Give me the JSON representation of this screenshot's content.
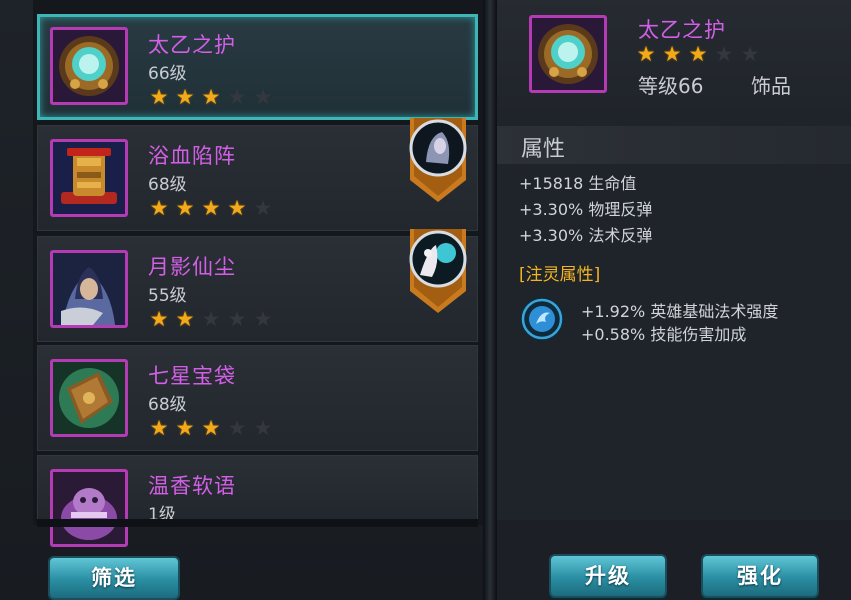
{
  "equipment_list": [
    {
      "name": "太乙之护",
      "level": "66级",
      "stars": 3,
      "max_stars": 5,
      "selected": true,
      "badge": false
    },
    {
      "name": "浴血陷阵",
      "level": "68级",
      "stars": 4,
      "max_stars": 5,
      "selected": false,
      "badge": true
    },
    {
      "name": "月影仙尘",
      "level": "55级",
      "stars": 2,
      "max_stars": 5,
      "selected": false,
      "badge": true
    },
    {
      "name": "七星宝袋",
      "level": "68级",
      "stars": 3,
      "max_stars": 5,
      "selected": false,
      "badge": false
    },
    {
      "name": "温香软语",
      "level": "1级",
      "stars": 0,
      "max_stars": 5,
      "selected": false,
      "badge": false
    }
  ],
  "buttons": {
    "filter": "筛选",
    "upgrade": "升级",
    "enhance": "强化"
  },
  "detail": {
    "name": "太乙之护",
    "stars": 3,
    "max_stars": 5,
    "level": "等级66",
    "type": "饰品",
    "attributes_title": "属性",
    "attributes": [
      "+15818 生命值",
      "+3.30% 物理反弹",
      "+3.30% 法术反弹"
    ],
    "infuse_title": "[注灵属性]",
    "infuse_attributes": [
      "+1.92% 英雄基础法术强度",
      "+0.58% 技能伤害加成"
    ]
  },
  "colors": {
    "rarity_border": "#b43bb4",
    "name_purple": "#d35fe6",
    "star_gold": "#f2a91a",
    "selected_border": "#3fb6b6",
    "infuse_gold": "#f2b521",
    "button_teal": "#2a8ea2"
  },
  "icons": {
    "star": "star-icon",
    "badge": "hero-badge-icon",
    "infuse": "spirit-orb-icon"
  }
}
